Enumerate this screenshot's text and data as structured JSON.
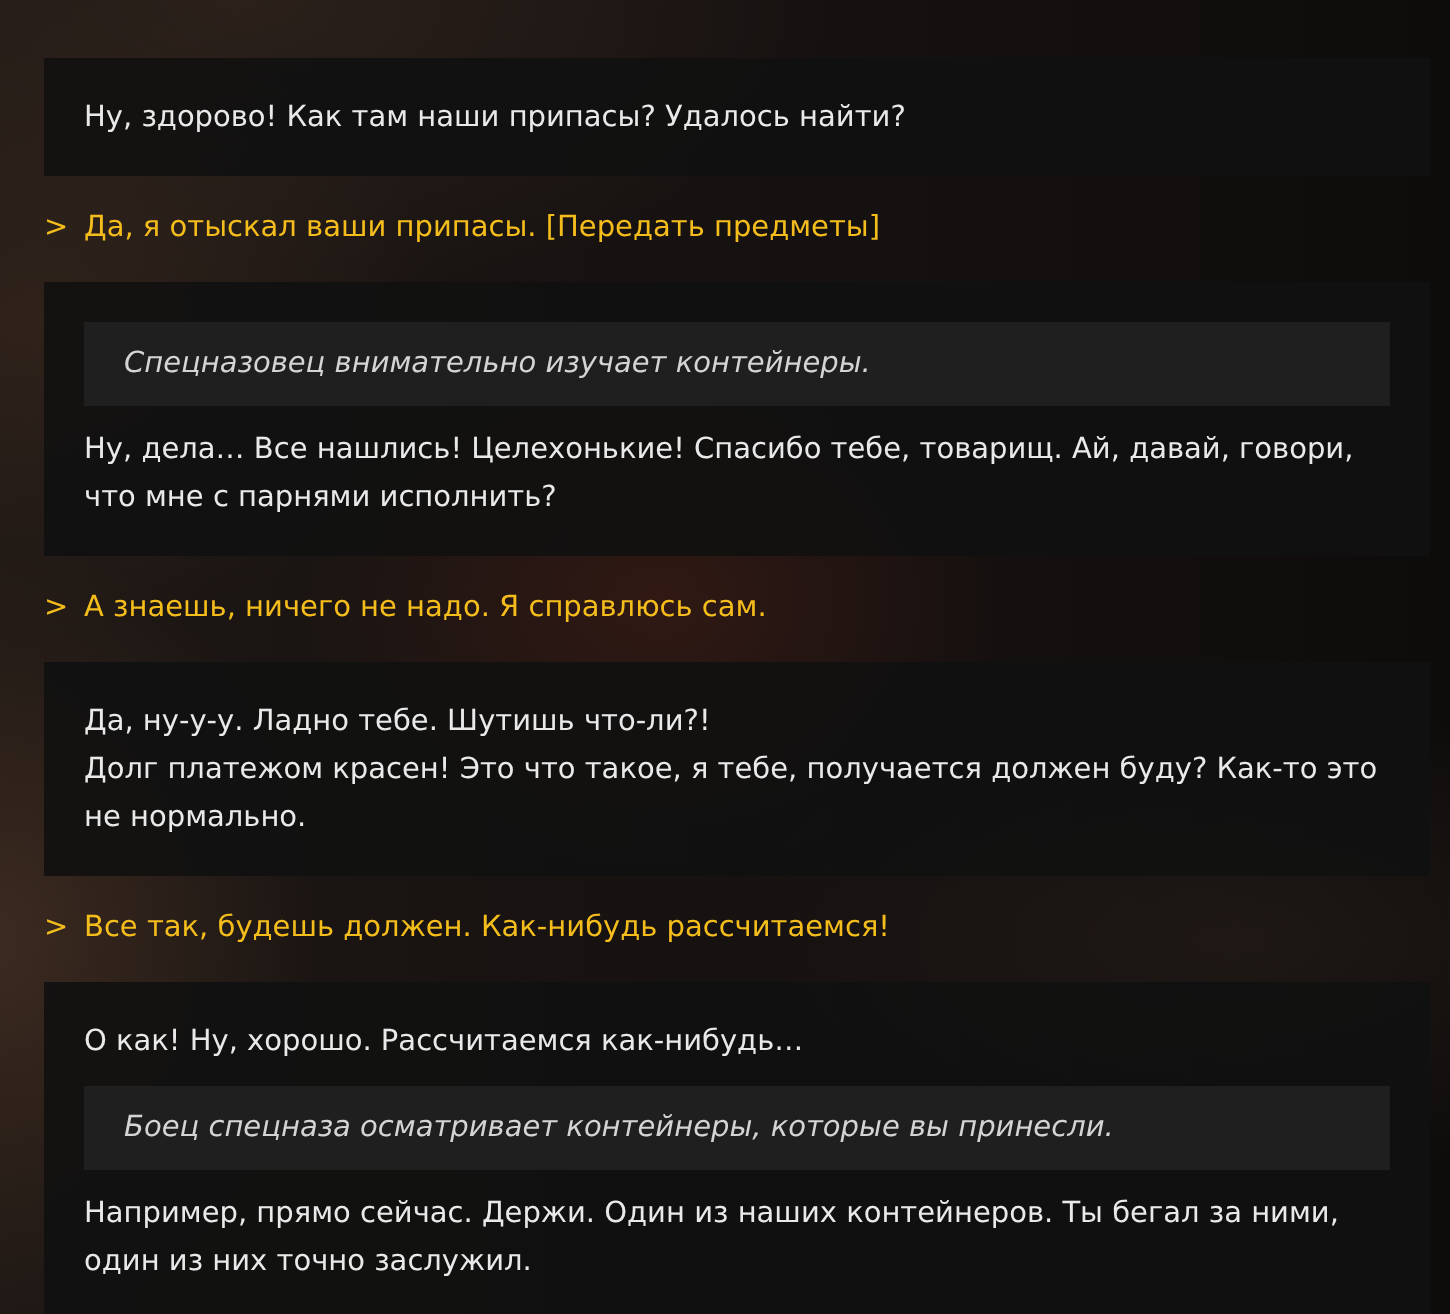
{
  "dialogue": [
    {
      "kind": "npc",
      "parts": [
        {
          "kind": "speech",
          "text": "Ну, здорово! Как там наши припасы? Удалось найти?"
        }
      ]
    },
    {
      "kind": "choice",
      "marker": ">",
      "text": "Да, я отыскал ваши припасы. [Передать предметы]"
    },
    {
      "kind": "npc",
      "parts": [
        {
          "kind": "narration",
          "text": "Спецназовец внимательно изучает контейнеры."
        },
        {
          "kind": "speech",
          "text": "Ну, дела… Все нашлись! Целехонькие! Спасибо тебе, товарищ. Ай, давай, говори, что мне с парнями исполнить?"
        }
      ]
    },
    {
      "kind": "choice",
      "marker": ">",
      "text": "А знаешь, ничего не надо. Я справлюсь сам."
    },
    {
      "kind": "npc",
      "parts": [
        {
          "kind": "speech",
          "text": "Да, ну-у-у. Ладно тебе. Шутишь что-ли?!"
        },
        {
          "kind": "speech",
          "text": "Долг платежом красен! Это что такое, я тебе, получается должен буду? Как-то это не нормально."
        }
      ]
    },
    {
      "kind": "choice",
      "marker": ">",
      "text": "Все так, будешь должен. Как-нибудь рассчитаемся!"
    },
    {
      "kind": "npc",
      "parts": [
        {
          "kind": "speech",
          "text": "О как! Ну, хорошо. Рассчитаемся как-нибудь…"
        },
        {
          "kind": "narration",
          "text": "Боец спецназа осматривает контейнеры, которые вы принесли."
        },
        {
          "kind": "speech",
          "text": "Например, прямо сейчас. Держи. Один из наших контейнеров. Ты бегал за ними, один из них точно заслужил."
        }
      ]
    }
  ]
}
